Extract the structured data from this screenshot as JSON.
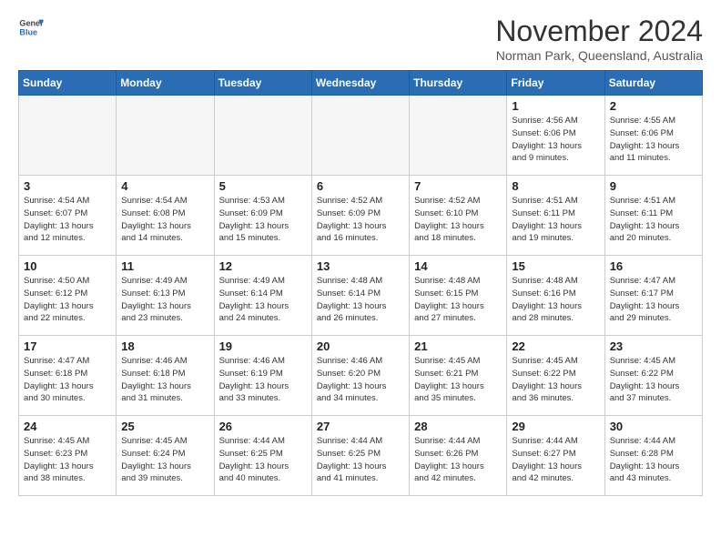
{
  "header": {
    "logo_general": "General",
    "logo_blue": "Blue",
    "month_title": "November 2024",
    "location": "Norman Park, Queensland, Australia"
  },
  "weekdays": [
    "Sunday",
    "Monday",
    "Tuesday",
    "Wednesday",
    "Thursday",
    "Friday",
    "Saturday"
  ],
  "weeks": [
    [
      {
        "day": "",
        "info": "",
        "empty": true
      },
      {
        "day": "",
        "info": "",
        "empty": true
      },
      {
        "day": "",
        "info": "",
        "empty": true
      },
      {
        "day": "",
        "info": "",
        "empty": true
      },
      {
        "day": "",
        "info": "",
        "empty": true
      },
      {
        "day": "1",
        "info": "Sunrise: 4:56 AM\nSunset: 6:06 PM\nDaylight: 13 hours\nand 9 minutes.",
        "empty": false
      },
      {
        "day": "2",
        "info": "Sunrise: 4:55 AM\nSunset: 6:06 PM\nDaylight: 13 hours\nand 11 minutes.",
        "empty": false
      }
    ],
    [
      {
        "day": "3",
        "info": "Sunrise: 4:54 AM\nSunset: 6:07 PM\nDaylight: 13 hours\nand 12 minutes.",
        "empty": false
      },
      {
        "day": "4",
        "info": "Sunrise: 4:54 AM\nSunset: 6:08 PM\nDaylight: 13 hours\nand 14 minutes.",
        "empty": false
      },
      {
        "day": "5",
        "info": "Sunrise: 4:53 AM\nSunset: 6:09 PM\nDaylight: 13 hours\nand 15 minutes.",
        "empty": false
      },
      {
        "day": "6",
        "info": "Sunrise: 4:52 AM\nSunset: 6:09 PM\nDaylight: 13 hours\nand 16 minutes.",
        "empty": false
      },
      {
        "day": "7",
        "info": "Sunrise: 4:52 AM\nSunset: 6:10 PM\nDaylight: 13 hours\nand 18 minutes.",
        "empty": false
      },
      {
        "day": "8",
        "info": "Sunrise: 4:51 AM\nSunset: 6:11 PM\nDaylight: 13 hours\nand 19 minutes.",
        "empty": false
      },
      {
        "day": "9",
        "info": "Sunrise: 4:51 AM\nSunset: 6:11 PM\nDaylight: 13 hours\nand 20 minutes.",
        "empty": false
      }
    ],
    [
      {
        "day": "10",
        "info": "Sunrise: 4:50 AM\nSunset: 6:12 PM\nDaylight: 13 hours\nand 22 minutes.",
        "empty": false
      },
      {
        "day": "11",
        "info": "Sunrise: 4:49 AM\nSunset: 6:13 PM\nDaylight: 13 hours\nand 23 minutes.",
        "empty": false
      },
      {
        "day": "12",
        "info": "Sunrise: 4:49 AM\nSunset: 6:14 PM\nDaylight: 13 hours\nand 24 minutes.",
        "empty": false
      },
      {
        "day": "13",
        "info": "Sunrise: 4:48 AM\nSunset: 6:14 PM\nDaylight: 13 hours\nand 26 minutes.",
        "empty": false
      },
      {
        "day": "14",
        "info": "Sunrise: 4:48 AM\nSunset: 6:15 PM\nDaylight: 13 hours\nand 27 minutes.",
        "empty": false
      },
      {
        "day": "15",
        "info": "Sunrise: 4:48 AM\nSunset: 6:16 PM\nDaylight: 13 hours\nand 28 minutes.",
        "empty": false
      },
      {
        "day": "16",
        "info": "Sunrise: 4:47 AM\nSunset: 6:17 PM\nDaylight: 13 hours\nand 29 minutes.",
        "empty": false
      }
    ],
    [
      {
        "day": "17",
        "info": "Sunrise: 4:47 AM\nSunset: 6:18 PM\nDaylight: 13 hours\nand 30 minutes.",
        "empty": false
      },
      {
        "day": "18",
        "info": "Sunrise: 4:46 AM\nSunset: 6:18 PM\nDaylight: 13 hours\nand 31 minutes.",
        "empty": false
      },
      {
        "day": "19",
        "info": "Sunrise: 4:46 AM\nSunset: 6:19 PM\nDaylight: 13 hours\nand 33 minutes.",
        "empty": false
      },
      {
        "day": "20",
        "info": "Sunrise: 4:46 AM\nSunset: 6:20 PM\nDaylight: 13 hours\nand 34 minutes.",
        "empty": false
      },
      {
        "day": "21",
        "info": "Sunrise: 4:45 AM\nSunset: 6:21 PM\nDaylight: 13 hours\nand 35 minutes.",
        "empty": false
      },
      {
        "day": "22",
        "info": "Sunrise: 4:45 AM\nSunset: 6:22 PM\nDaylight: 13 hours\nand 36 minutes.",
        "empty": false
      },
      {
        "day": "23",
        "info": "Sunrise: 4:45 AM\nSunset: 6:22 PM\nDaylight: 13 hours\nand 37 minutes.",
        "empty": false
      }
    ],
    [
      {
        "day": "24",
        "info": "Sunrise: 4:45 AM\nSunset: 6:23 PM\nDaylight: 13 hours\nand 38 minutes.",
        "empty": false
      },
      {
        "day": "25",
        "info": "Sunrise: 4:45 AM\nSunset: 6:24 PM\nDaylight: 13 hours\nand 39 minutes.",
        "empty": false
      },
      {
        "day": "26",
        "info": "Sunrise: 4:44 AM\nSunset: 6:25 PM\nDaylight: 13 hours\nand 40 minutes.",
        "empty": false
      },
      {
        "day": "27",
        "info": "Sunrise: 4:44 AM\nSunset: 6:25 PM\nDaylight: 13 hours\nand 41 minutes.",
        "empty": false
      },
      {
        "day": "28",
        "info": "Sunrise: 4:44 AM\nSunset: 6:26 PM\nDaylight: 13 hours\nand 42 minutes.",
        "empty": false
      },
      {
        "day": "29",
        "info": "Sunrise: 4:44 AM\nSunset: 6:27 PM\nDaylight: 13 hours\nand 42 minutes.",
        "empty": false
      },
      {
        "day": "30",
        "info": "Sunrise: 4:44 AM\nSunset: 6:28 PM\nDaylight: 13 hours\nand 43 minutes.",
        "empty": false
      }
    ]
  ]
}
